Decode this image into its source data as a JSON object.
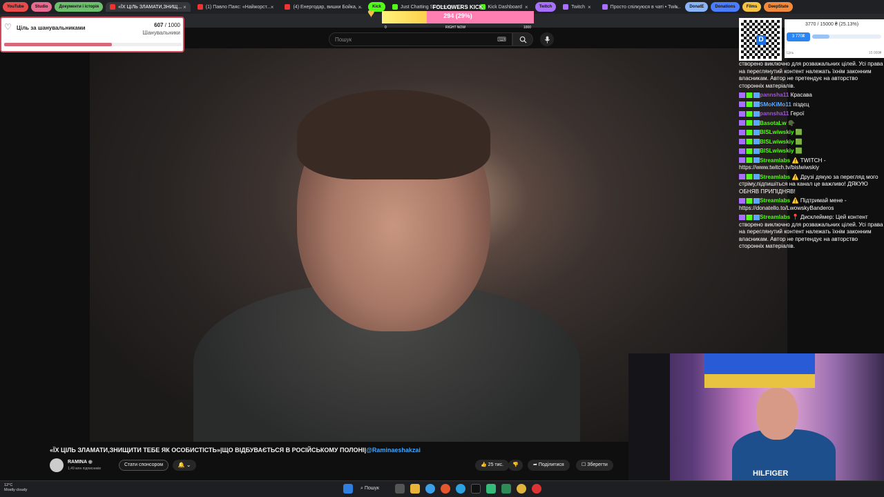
{
  "browser": {
    "tabs": [
      {
        "label": "YouTube",
        "style": "pill",
        "color": "#e94a4a"
      },
      {
        "label": "Studio",
        "style": "pill",
        "color": "#e86b8f"
      },
      {
        "label": "Документи і історія",
        "style": "pill",
        "color": "#6cc06b"
      },
      {
        "label": "«ЇХ ЦІЛЬ ЗЛАМАТИ,ЗНИЩ...",
        "style": "active",
        "color": "#e33"
      },
      {
        "label": "(1) Павло Паяс: «Найжорст...",
        "style": "normal",
        "color": "#e33"
      },
      {
        "label": "(4) Енергодар, вишки Бойка, ...",
        "style": "normal",
        "color": "#e33"
      },
      {
        "label": "Kick",
        "style": "pill",
        "color": "#53fc18"
      },
      {
        "label": "Just Chatting Streaming – Liv...",
        "style": "normal",
        "color": "#53fc18"
      },
      {
        "label": "Kick Dashboard",
        "style": "normal",
        "color": "#53fc18"
      },
      {
        "label": "Twitch",
        "style": "pill",
        "color": "#a970ff"
      },
      {
        "label": "Twitch",
        "style": "normal",
        "color": "#a970ff"
      },
      {
        "label": "Просто спілкуюся в чаті • Twit...",
        "style": "normal",
        "color": "#a970ff"
      },
      {
        "label": "DonatE",
        "style": "pill",
        "color": "#8ab4f8"
      },
      {
        "label": "Donations",
        "style": "pill",
        "color": "#4a7dff"
      },
      {
        "label": "Films",
        "style": "pill",
        "color": "#f5c242"
      },
      {
        "label": "DeepState",
        "style": "pill",
        "color": "#f08a3c"
      }
    ]
  },
  "youtube": {
    "search_placeholder": "Пошук",
    "video_title": "«ЇХ ЦІЛЬ ЗЛАМАТИ,ЗНИЩИТИ ТЕБЕ ЯК ОСОБИСТІСТЬ»|ЩО ВІДБУВАЄТЬСЯ В РОСІЙСЬКОМУ ПОЛОНІ|",
    "video_mention": "@Raminaeshakzai",
    "channel_name": "RAMINA",
    "channel_verified": "◉",
    "subscribers": "1,49 млн підписників",
    "sponsor_label": "Стати спонсором",
    "bell_label": "🔔 ⌄",
    "likes": "25 тис.",
    "share_label": "Поділитися",
    "save_label": "Зберегти"
  },
  "goal_widget": {
    "title": "Ціль за шанувальниками",
    "current": "607",
    "total": "/ 1000",
    "unit": "Шанувальники",
    "progress": 0.607
  },
  "kick_goal": {
    "label": "FOLLOWERS KICK",
    "value": "294 (29%)",
    "progress": 0.294,
    "min": "0",
    "mid": "RIGHT NOW",
    "max": "1000"
  },
  "donation_widget": {
    "summary": "3770 / 15000 ₴ (25.13%)",
    "raised": "3 770₴",
    "progress": 0.2513,
    "left_label": "Ціль",
    "right_label": "15 000₴",
    "qr_logo": "D"
  },
  "chat": {
    "messages": [
      {
        "name": "",
        "color": "#ffffff",
        "text": "створено виключно для розважальних цілей. Усі права на переглянутий контент належать їхнім законним власникам. Автор не претендує на авторство сторонніх матеріалів."
      },
      {
        "name": "pannsha11",
        "color": "#9b59d0",
        "text": "Красава"
      },
      {
        "name": "SMoKiMo11",
        "color": "#5aa9ff",
        "text": "піздєц"
      },
      {
        "name": "pannsha11",
        "color": "#9b59d0",
        "text": "Герої"
      },
      {
        "name": "BasotaLw",
        "color": "#53fc18",
        "text": "🪖"
      },
      {
        "name": "BISLwiwskiy",
        "color": "#53fc18",
        "text": "🟩"
      },
      {
        "name": "BISLwiwskiy",
        "color": "#53fc18",
        "text": "🟩"
      },
      {
        "name": "BISLwiwskiy",
        "color": "#53fc18",
        "text": "🟩"
      },
      {
        "name": "Streamlabs",
        "color": "#53fc18",
        "text": "⚠️ TWITCH - https://www.twitch.tv/bislwiwskiy"
      },
      {
        "name": "Streamlabs",
        "color": "#53fc18",
        "text": "⚠️ Друзі дякую за перегляд мого стріму,підпишіться на канал це важливо! ДЯКУЮ ОБНЯВ ПРИПІДНЯВ!"
      },
      {
        "name": "Streamlabs",
        "color": "#53fc18",
        "text": "⚠️ Підтримай мене - https://donatello.to/LwowskyBanderos"
      },
      {
        "name": "Streamlabs",
        "color": "#53fc18",
        "text": "📍 Дисклеймер: Цей контент створено виключно для розважальних цілей. Усі права на переглянутий контент належать їхнім законним власникам. Автор не претендує на авторство сторонніх матеріалів."
      }
    ]
  },
  "webcam": {
    "shirt_text": "HILFIGER"
  },
  "taskbar": {
    "temperature": "12°C",
    "weather": "Mostly cloudy",
    "search_label": "Пошук"
  },
  "colors": {
    "accent_red": "#d14a5c",
    "kick_green": "#53fc18",
    "youtube_bg": "#0f0f0f"
  }
}
